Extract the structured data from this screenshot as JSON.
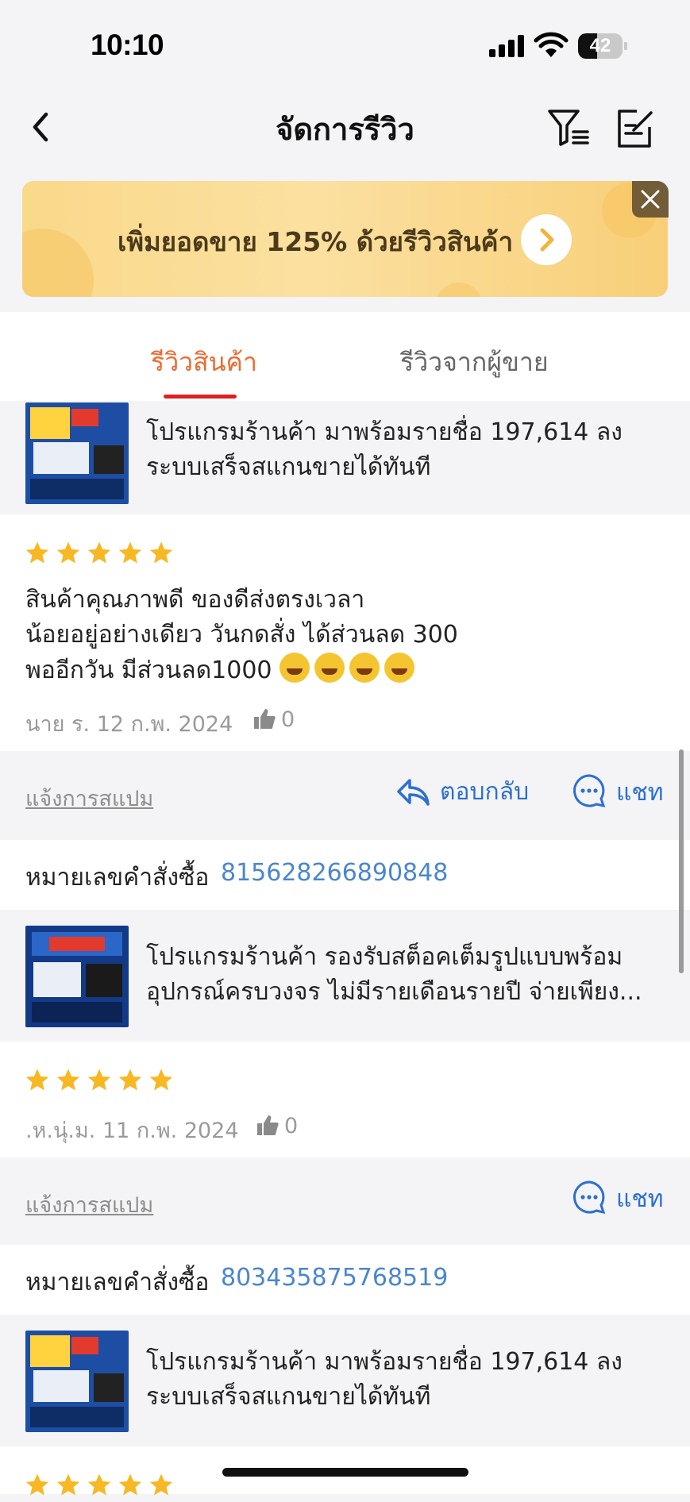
{
  "status_bar": {
    "time": "10:10",
    "battery": "42",
    "battery_level": 0.42
  },
  "nav": {
    "title": "จัดการรีวิว"
  },
  "banner": {
    "text": "เพิ่มยอดขาย 125% ด้วยรีวิวสินค้า"
  },
  "tabs": [
    {
      "label": "รีวิวสินค้า",
      "active": true
    },
    {
      "label": "รีวิวจากผู้ขาย",
      "active": false
    }
  ],
  "colors": {
    "accent": "#ee6a2f",
    "tab_underline": "#e02020",
    "link": "#2c6fd1",
    "star": "#f7b824"
  },
  "reviews": [
    {
      "product_name": "โปรแกรมร้านค้า มาพร้อมรายชื่อ 197,614 ลง ระบบเสร็จสแกนขายได้ทันที",
      "rating": 5,
      "text_lines": [
        "สินค้าคุณภาพดี ของดีส่งตรงเวลา",
        "น้อยอยู่อย่างเดียว วันกดสั่ง ได้ส่วนลด 300",
        "พออีกวัน มีส่วนลด1000"
      ],
      "emoji": "rolling-on-floor-laughing",
      "emoji_count": 4,
      "reviewer": "นาย ร.",
      "date": "12 ก.พ. 2024",
      "likes": "0",
      "report_label": "แจ้งการสแปม",
      "reply_label": "ตอบกลับ",
      "chat_label": "แชท"
    },
    {
      "order_label": "หมายเลขคำสั่งซื้อ",
      "order_number": "815628266890848",
      "product_name": "โปรแกรมร้านค้า รองรับสต็อคเต็มรูปแบบพร้อม อุปกรณ์ครบวงจร ไม่มีรายเดือนรายปี จ่ายเพียง...",
      "rating": 5,
      "reviewer": ".ห.นุ่.ม.",
      "date": "11 ก.พ. 2024",
      "likes": "0",
      "report_label": "แจ้งการสแปม",
      "chat_label": "แชท"
    },
    {
      "order_label": "หมายเลขคำสั่งซื้อ",
      "order_number": "803435875768519",
      "product_name": "โปรแกรมร้านค้า มาพร้อมรายชื่อ 197,614 ลง ระบบเสร็จสแกนขายได้ทันที",
      "rating": 5
    }
  ]
}
